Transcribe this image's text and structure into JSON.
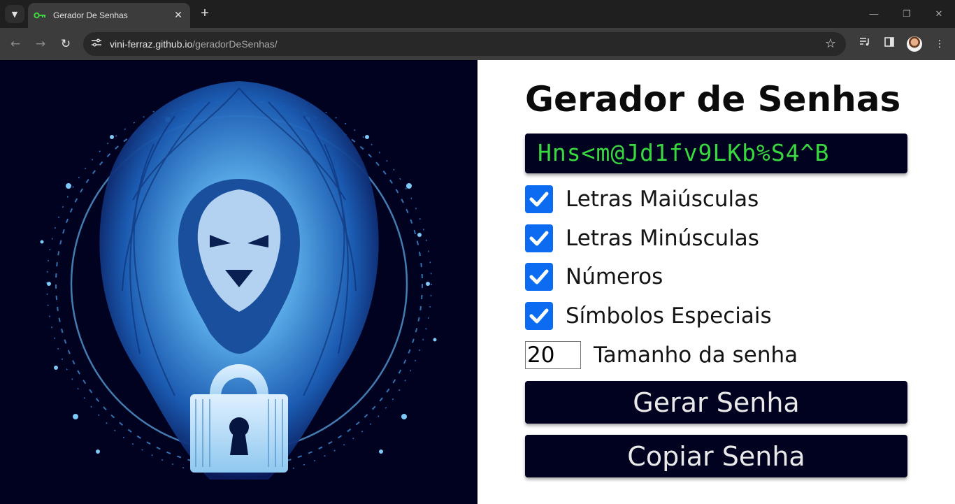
{
  "browser": {
    "tab_title": "Gerador De Senhas",
    "new_tab_label": "+",
    "url_host": "vini-ferraz.github.io",
    "url_path": "/geradorDeSenhas/",
    "favicon": "key-icon"
  },
  "page": {
    "title": "Gerador de Senhas",
    "password": "Hns<m@Jd1fv9LKb%S4^B",
    "options": [
      {
        "label": "Letras Maiúsculas",
        "checked": true
      },
      {
        "label": "Letras Minúsculas",
        "checked": true
      },
      {
        "label": "Números",
        "checked": true
      },
      {
        "label": "Símbolos Especiais",
        "checked": true
      }
    ],
    "length_value": "20",
    "length_label": "Tamanho da senha",
    "generate_label": "Gerar Senha",
    "copy_label": "Copiar Senha",
    "hero_image": "lion-padlock-illustration"
  },
  "colors": {
    "dark_navy": "#010120",
    "password_green": "#38d93f",
    "checkbox_blue": "#0b6cf2"
  }
}
